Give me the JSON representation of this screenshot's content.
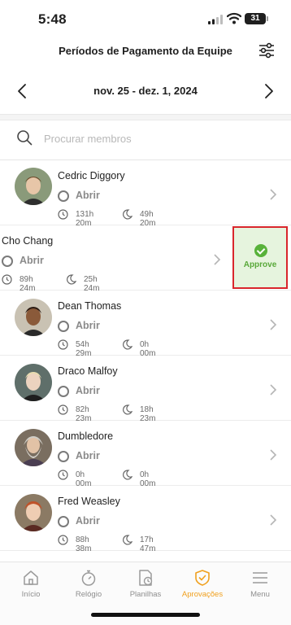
{
  "status_bar": {
    "time": "5:48",
    "battery": "31"
  },
  "header": {
    "title": "Períodos de Pagamento da Equipe",
    "filter_icon": "sliders-icon"
  },
  "date_nav": {
    "range": "nov. 25 - dez. 1, 2024"
  },
  "search": {
    "placeholder": "Procurar membros",
    "value": ""
  },
  "members": [
    {
      "name": "Cedric Diggory",
      "status": "Abrir",
      "regular": "131h 20m",
      "overtime": "49h 20m"
    },
    {
      "name": "Cho Chang",
      "status": "Abrir",
      "regular": "89h 24m",
      "overtime": "25h 24m",
      "action": "Approve"
    },
    {
      "name": "Dean Thomas",
      "status": "Abrir",
      "regular": "54h 29m",
      "overtime": "0h 00m"
    },
    {
      "name": "Draco Malfoy",
      "status": "Abrir",
      "regular": "82h 23m",
      "overtime": "18h 23m"
    },
    {
      "name": "Dumbledore",
      "status": "Abrir",
      "regular": "0h 00m",
      "overtime": "0h 00m"
    },
    {
      "name": "Fred Weasley",
      "status": "Abrir",
      "regular": "88h 38m",
      "overtime": "17h 47m"
    }
  ],
  "tabs": [
    {
      "label": "Início",
      "icon": "home-icon"
    },
    {
      "label": "Relógio",
      "icon": "stopwatch-icon"
    },
    {
      "label": "Planilhas",
      "icon": "timesheet-icon"
    },
    {
      "label": "Aprovações",
      "icon": "shield-check-icon",
      "active": true
    },
    {
      "label": "Menu",
      "icon": "menu-icon"
    }
  ],
  "colors": {
    "accent": "#f0a01e",
    "approve_green": "#58b23a",
    "approve_bg": "#e6f4de",
    "highlight_red": "#d9262c"
  }
}
